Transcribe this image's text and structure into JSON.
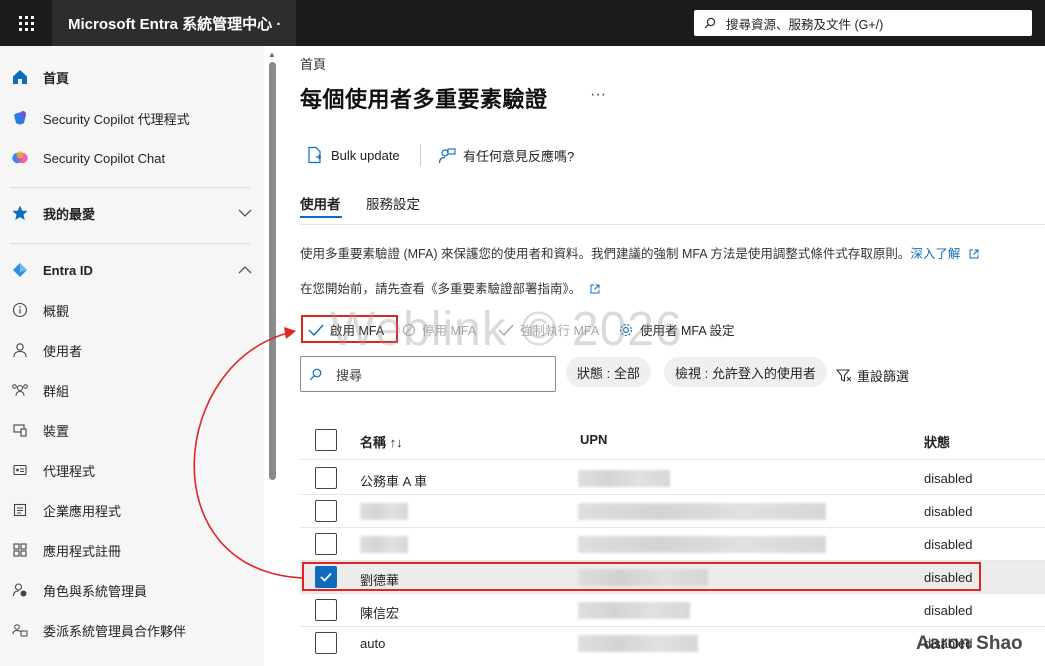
{
  "header": {
    "brand": "Microsoft Entra 系統管理中心 ·",
    "search_placeholder": "搜尋資源、服務及文件 (G+/)"
  },
  "sidebar": {
    "items": [
      {
        "label": "首頁",
        "icon": "home-icon"
      },
      {
        "label": "Security Copilot 代理程式",
        "icon": "copilot-agent-icon"
      },
      {
        "label": "Security Copilot Chat",
        "icon": "copilot-chat-icon"
      },
      {
        "label": "我的最愛",
        "icon": "star-icon"
      },
      {
        "label": "Entra ID",
        "icon": "entra-icon"
      },
      {
        "label": "概觀",
        "icon": "info-icon"
      },
      {
        "label": "使用者",
        "icon": "person-icon"
      },
      {
        "label": "群組",
        "icon": "group-icon"
      },
      {
        "label": "裝置",
        "icon": "devices-icon"
      },
      {
        "label": "代理程式",
        "icon": "agent-card-icon"
      },
      {
        "label": "企業應用程式",
        "icon": "enterprise-app-icon"
      },
      {
        "label": "應用程式註冊",
        "icon": "app-registration-icon"
      },
      {
        "label": "角色與系統管理員",
        "icon": "roles-icon"
      },
      {
        "label": "委派系統管理員合作夥伴",
        "icon": "partner-icon"
      }
    ]
  },
  "main": {
    "breadcrumb": "首頁",
    "title": "每個使用者多重要素驗證",
    "more": "···",
    "commands": {
      "bulk_update": "Bulk update",
      "feedback": "有任何意見反應嗎?"
    },
    "tabs": [
      "使用者",
      "服務設定"
    ],
    "description": "使用多重要素驗證 (MFA) 來保護您的使用者和資料。我們建議的強制 MFA 方法是使用調整式條件式存取原則。",
    "learn_more": "深入了解",
    "guide_text": "在您開始前，請先查看《多重要素驗證部署指南》。",
    "actions": {
      "enable": "啟用 MFA",
      "disable": "停用 MFA",
      "enforce": "強制執行 MFA",
      "user_settings": "使用者 MFA 設定"
    },
    "filter": {
      "search_placeholder": "搜尋",
      "status": "狀態 : 全部",
      "view": "檢視 : 允許登入的使用者",
      "reset": "重設篩選"
    },
    "table": {
      "headers": {
        "name": "名稱 ↑↓",
        "upn": "UPN",
        "status": "狀態"
      },
      "rows": [
        {
          "name": "公務車 A 車",
          "status": "disabled",
          "selected": false
        },
        {
          "name": "",
          "status": "disabled",
          "selected": false
        },
        {
          "name": "",
          "status": "disabled",
          "selected": false
        },
        {
          "name": "劉德華",
          "status": "disabled",
          "selected": true
        },
        {
          "name": "陳信宏",
          "status": "disabled",
          "selected": false
        },
        {
          "name": "auto",
          "status": "disabled",
          "selected": false
        }
      ]
    }
  },
  "overlay": {
    "watermark": "Weblink © 2026",
    "author": "Aaron Shao",
    "highlight_color": "#e02424"
  }
}
